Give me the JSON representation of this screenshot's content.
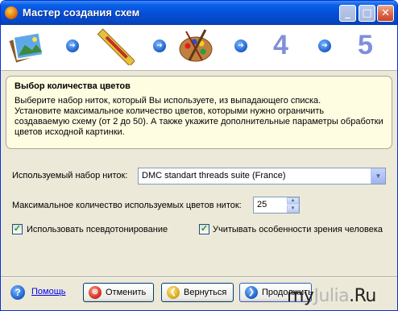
{
  "window": {
    "title": "Мастер создания схем",
    "controls": {
      "minimize": "_",
      "maximize": "□",
      "close": "✕"
    }
  },
  "steps": {
    "icons": [
      "photo-icon",
      "ruler-icon",
      "palette-icon"
    ],
    "numbers": [
      "4",
      "5"
    ],
    "arrow": "➔"
  },
  "info": {
    "title": "Выбор количества цветов",
    "line1": "Выберите набор ниток, который Вы используете, из выпадающего списка.",
    "line2": "Установите максимальное количество цветов, которыми нужно ограничить",
    "line3": "создаваемую схему (от 2 до 50). А также укажите дополнительные параметры обработки",
    "line4": "цветов исходной картинки."
  },
  "form": {
    "thread_label": "Используемый набор ниток:",
    "thread_value": "DMC standart threads suite (France)",
    "colors_label": "Максимальное количество используемых цветов ниток:",
    "colors_value": "25",
    "pseudo_label": "Использовать псевдотонирование",
    "pseudo_checked": true,
    "vision_label": "Учитывать особенности зрения человека",
    "vision_checked": true,
    "check_mark": "✓"
  },
  "footer": {
    "help": "Помощь",
    "cancel": "Отменить",
    "back": "Вернуться",
    "next": "Продолжить",
    "watermark_a": "my",
    "watermark_b": "Julia",
    "watermark_c": ".Ru"
  },
  "colors": {
    "titlebar": "#0550d8",
    "accent_numbers": "#7f8fdc",
    "info_bg": "#fffde1"
  }
}
